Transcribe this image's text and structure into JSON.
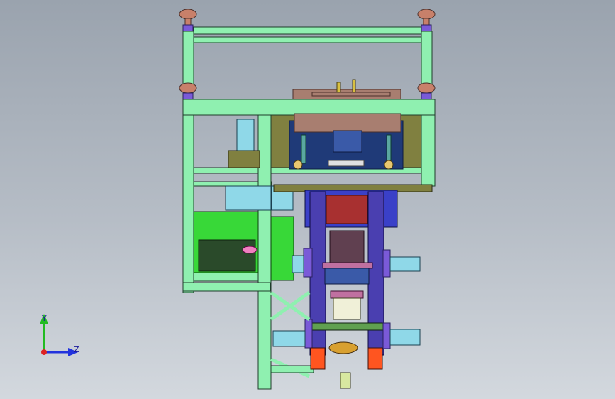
{
  "viewport": {
    "background_top": "#9aa3ae",
    "background_bottom": "#d3d8de"
  },
  "triad": {
    "y_label": "Y",
    "z_label": "Z",
    "y_color": "#22bb22",
    "z_color": "#2233dd",
    "origin_color": "#dd2222"
  },
  "model": {
    "frame_color": "#8ff0b0",
    "frame_edge": "#1f3b2a",
    "panel_color": "#808040",
    "plate_color": "#a87e70",
    "plate_edge": "#4a2f2a",
    "tank_color": "#1f3a78",
    "column_color": "#4a3fb0",
    "box_color": "#38d838",
    "screen_color": "#8fd8e8",
    "knob_color": "#c8806a",
    "orange_color": "#ff5520"
  }
}
